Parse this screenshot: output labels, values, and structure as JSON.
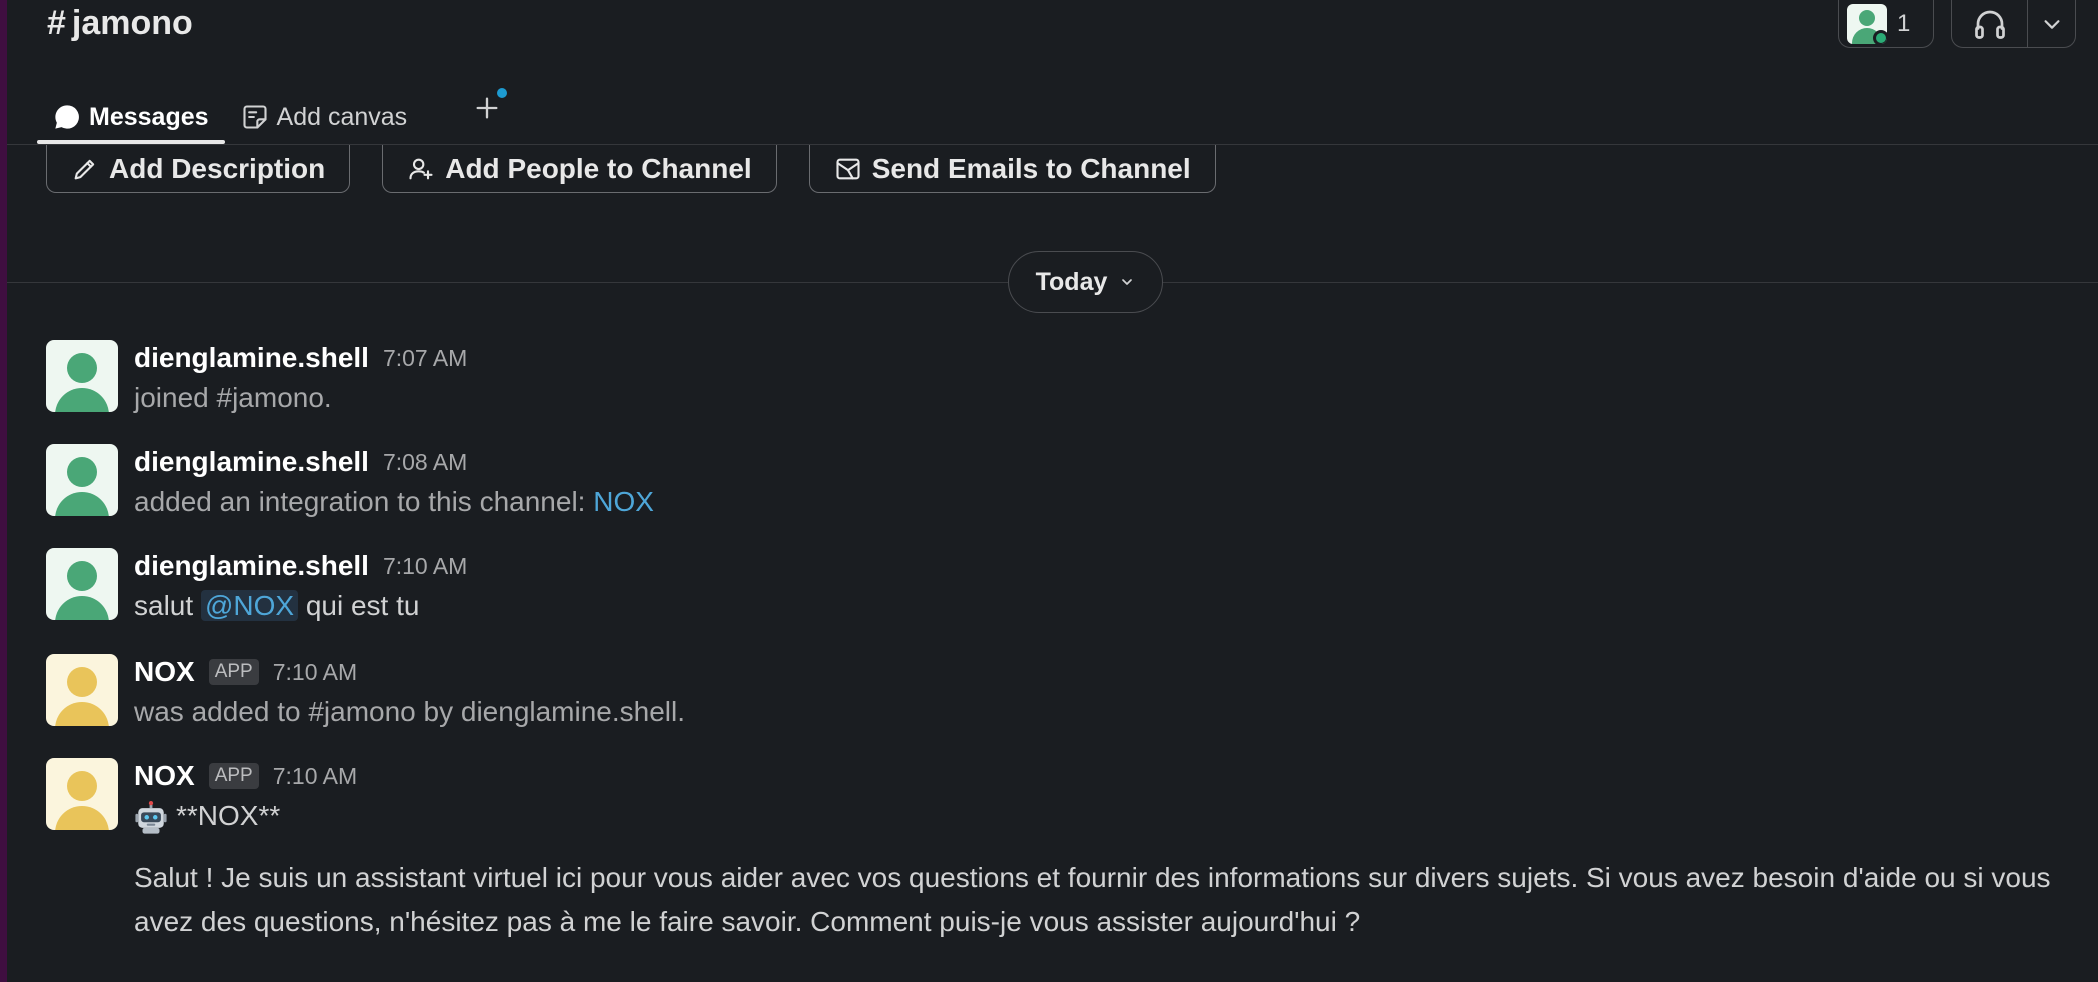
{
  "header": {
    "hash": "#",
    "channel_name": "jamono",
    "member_count": "1"
  },
  "tabs": [
    {
      "label": "Messages",
      "icon": "message-icon"
    },
    {
      "label": "Add canvas",
      "icon": "canvas-icon"
    }
  ],
  "actions": [
    {
      "label": "Add Description",
      "icon": "pencil-icon"
    },
    {
      "label": "Add People to Channel",
      "icon": "add-person-icon"
    },
    {
      "label": "Send Emails to Channel",
      "icon": "email-icon"
    }
  ],
  "day_divider": {
    "label": "Today"
  },
  "messages": [
    {
      "author": "dienglamine.shell",
      "time": "7:07 AM",
      "text": "joined #jamono."
    },
    {
      "author": "dienglamine.shell",
      "time": "7:08 AM",
      "text": "added an integration to this channel: ",
      "link": "NOX"
    },
    {
      "author": "dienglamine.shell",
      "time": "7:10 AM",
      "text_before": "salut ",
      "mention": "@NOX",
      "text_after": " qui est tu"
    },
    {
      "author": "NOX",
      "badge": "APP",
      "time": "7:10 AM",
      "text": "was added to #jamono by dienglamine.shell."
    },
    {
      "author": "NOX",
      "badge": "APP",
      "time": "7:10 AM",
      "title": "**NOX**",
      "body": "Salut ! Je suis un assistant virtuel ici pour vous aider avec vos questions et fournir des informations sur divers sujets. Si vous avez besoin d'aide ou si vous avez des questions, n'hésitez pas à me le faire savoir. Comment puis-je vous assister aujourd'hui ?"
    }
  ],
  "colors": {
    "background": "#1a1d21",
    "link": "#4ea6d8",
    "presence": "#2bac76",
    "avatar_green": "#4aa777",
    "avatar_yellow": "#e9c45a"
  }
}
